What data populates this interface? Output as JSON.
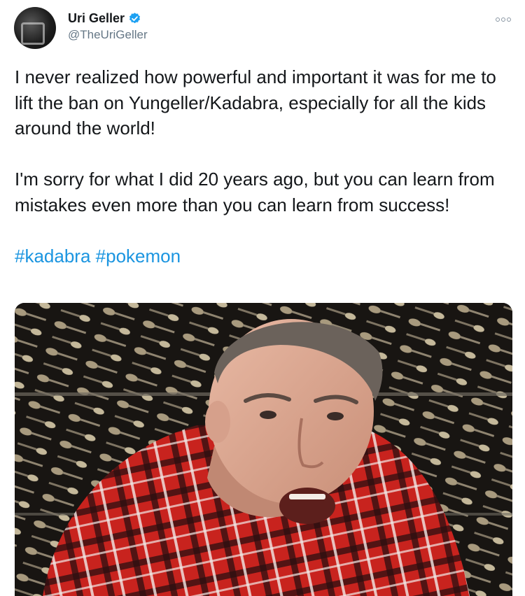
{
  "author": {
    "display_name": "Uri Geller",
    "handle": "@TheUriGeller",
    "verified_icon": "verified-badge-icon",
    "avatar_icon": "avatar-photo",
    "more_icon": "more-options-icon"
  },
  "tweet": {
    "paragraph_1": "I never realized how powerful and important it was for me to lift the ban on Yungeller/Kadabra, especially for all the kids around the world!",
    "paragraph_2": "I'm sorry for what I did 20 years ago, but you can learn from mistakes even more than you can learn from success!",
    "hashtag_1": "#kadabra",
    "hashtag_2": "#pokemon"
  },
  "media": {
    "kind": "video-thumbnail",
    "description_icon": "video-frame-man-in-plaid-shirt-spoon-wall"
  },
  "colors": {
    "link": "#1b95e0",
    "verified": "#1da1f2",
    "text": "#14171a",
    "muted": "#657786"
  }
}
